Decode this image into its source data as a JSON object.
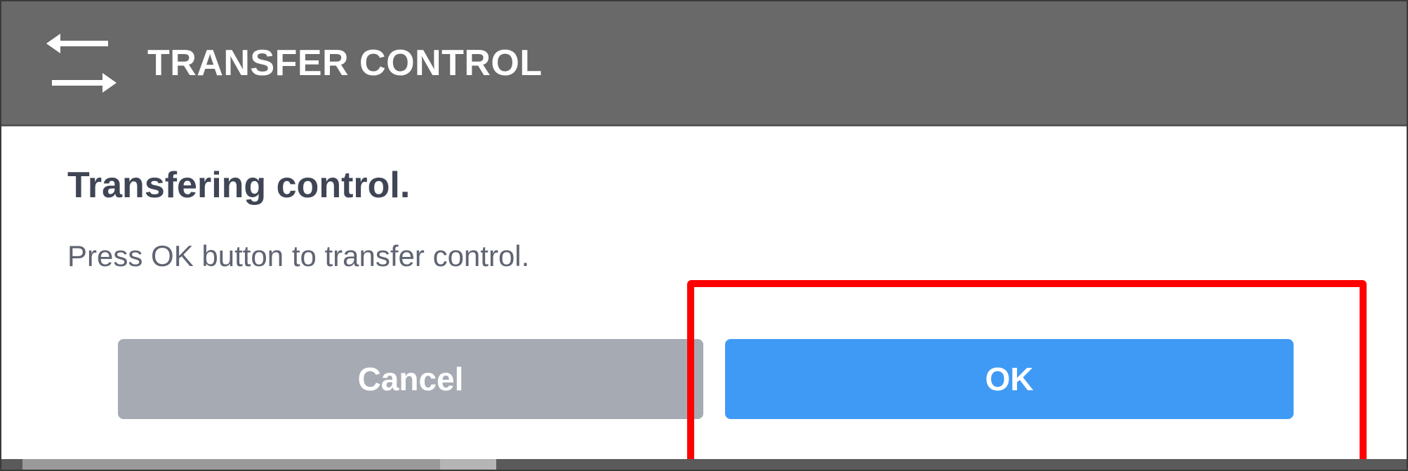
{
  "header": {
    "title": "TRANSFER CONTROL",
    "icon": "transfer-arrows-icon"
  },
  "dialog": {
    "heading": "Transfering control.",
    "message": "Press OK button to transfer control."
  },
  "buttons": {
    "cancel_label": "Cancel",
    "ok_label": "OK"
  },
  "colors": {
    "header_bg": "#696969",
    "cancel_bg": "#a6aab3",
    "ok_bg": "#3f9af5",
    "highlight": "#ff0000"
  }
}
